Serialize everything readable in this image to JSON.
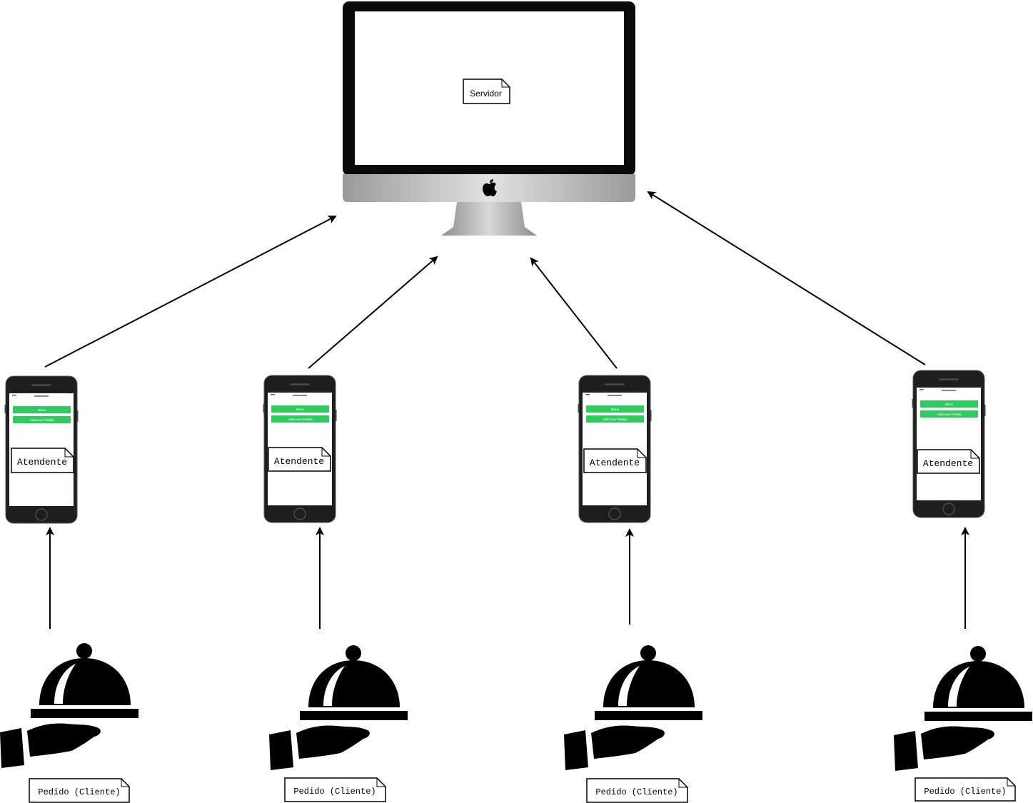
{
  "server": {
    "label": "Servidor",
    "icon": "apple-logo-icon"
  },
  "phones": [
    {
      "label": "Atendente",
      "button_1": "Menu",
      "button_2": "Adicionar Pedido"
    },
    {
      "label": "Atendente",
      "button_1": "Menu",
      "button_2": "Adicionar Pedido"
    },
    {
      "label": "Atendente",
      "button_1": "Menu",
      "button_2": "Adicionar Pedido"
    },
    {
      "label": "Atendente",
      "button_1": "Menu",
      "button_2": "Adicionar Pedido"
    }
  ],
  "clients": [
    {
      "label": "Pedido (Cliente)",
      "icon": "serving-cloche-hand-icon"
    },
    {
      "label": "Pedido (Cliente)",
      "icon": "serving-cloche-hand-icon"
    },
    {
      "label": "Pedido (Cliente)",
      "icon": "serving-cloche-hand-icon"
    },
    {
      "label": "Pedido (Cliente)",
      "icon": "serving-cloche-hand-icon"
    }
  ],
  "colors": {
    "phone_button": "#2ecc5f",
    "device_body": "#1e1e1e",
    "monitor_bezel": "#0a0a0a",
    "stroke": "#000000"
  }
}
